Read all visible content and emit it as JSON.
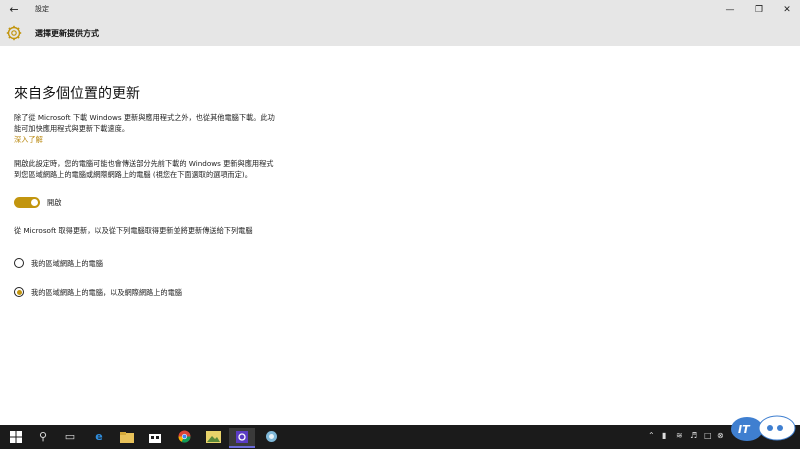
{
  "titlebar": {
    "title": "設定",
    "back_icon": "back-arrow-icon",
    "min": "—",
    "max": "❐",
    "close": "✕"
  },
  "header": {
    "title": "選擇更新提供方式",
    "icon": "gear-icon"
  },
  "main": {
    "heading": "來自多個位置的更新",
    "description": "除了從 Microsoft 下載 Windows 更新與應用程式之外，也從其他電腦下載。此功能可加快應用程式與更新下載速度。",
    "learn_more": "深入了解",
    "description2": "開啟此設定時，您的電腦可能也會傳送部分先前下載的 Windows 更新與應用程式到您區域網路上的電腦或網際網路上的電腦 (視您在下面選取的選項而定)。",
    "toggle_label": "開啟",
    "toggle_on": true,
    "description3": "從 Microsoft 取得更新，以及從下列電腦取得更新並將更新傳送給下列電腦",
    "options": [
      {
        "label": "我的區域網路上的電腦",
        "selected": false
      },
      {
        "label": "我的區域網路上的電腦，以及網際網路上的電腦",
        "selected": true
      }
    ]
  },
  "colors": {
    "accent": "#c2950e",
    "header_bg": "#e6e6e6",
    "taskbar_bg": "#1b1b1b"
  },
  "taskbar": {
    "items": [
      "start-icon",
      "search-icon",
      "task-view-icon",
      "edge-icon",
      "file-explorer-icon",
      "store-icon",
      "chrome-icon",
      "photos-icon",
      "settings-icon",
      "app-icon"
    ]
  }
}
